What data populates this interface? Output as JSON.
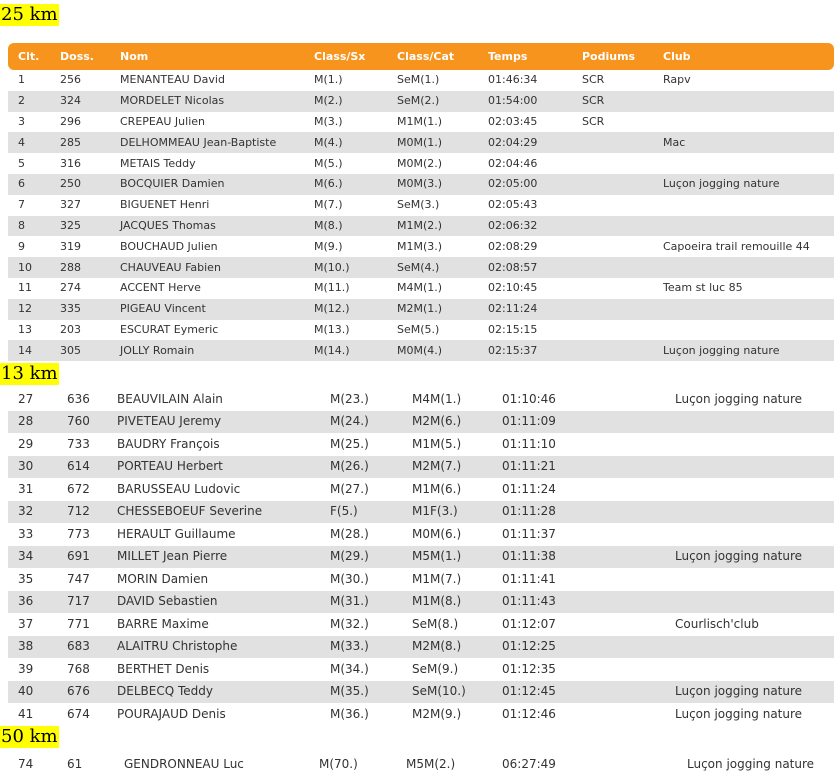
{
  "sections": [
    {
      "title": "25 km",
      "headers": [
        "Clt.",
        "Doss.",
        "Nom",
        "Class/Sx",
        "Class/Cat",
        "Temps",
        "Podiums",
        "Club"
      ],
      "rows": [
        [
          "1",
          "256",
          "MENANTEAU David",
          "M(1.)",
          "SeM(1.)",
          "01:46:34",
          "SCR",
          "Rapv"
        ],
        [
          "2",
          "324",
          "MORDELET Nicolas",
          "M(2.)",
          "SeM(2.)",
          "01:54:00",
          "SCR",
          ""
        ],
        [
          "3",
          "296",
          "CREPEAU Julien",
          "M(3.)",
          "M1M(1.)",
          "02:03:45",
          "SCR",
          ""
        ],
        [
          "4",
          "285",
          "DELHOMMEAU Jean-Baptiste",
          "M(4.)",
          "M0M(1.)",
          "02:04:29",
          "",
          "Mac"
        ],
        [
          "5",
          "316",
          "METAIS Teddy",
          "M(5.)",
          "M0M(2.)",
          "02:04:46",
          "",
          ""
        ],
        [
          "6",
          "250",
          "BOCQUIER Damien",
          "M(6.)",
          "M0M(3.)",
          "02:05:00",
          "",
          "Luçon jogging nature"
        ],
        [
          "7",
          "327",
          "BIGUENET Henri",
          "M(7.)",
          "SeM(3.)",
          "02:05:43",
          "",
          ""
        ],
        [
          "8",
          "325",
          "JACQUES Thomas",
          "M(8.)",
          "M1M(2.)",
          "02:06:32",
          "",
          ""
        ],
        [
          "9",
          "319",
          "BOUCHAUD Julien",
          "M(9.)",
          "M1M(3.)",
          "02:08:29",
          "",
          "Capoeira trail remouille 44"
        ],
        [
          "10",
          "288",
          "CHAUVEAU Fabien",
          "M(10.)",
          "SeM(4.)",
          "02:08:57",
          "",
          ""
        ],
        [
          "11",
          "274",
          "ACCENT Herve",
          "M(11.)",
          "M4M(1.)",
          "02:10:45",
          "",
          "Team st luc 85"
        ],
        [
          "12",
          "335",
          "PIGEAU Vincent",
          "M(12.)",
          "M2M(1.)",
          "02:11:24",
          "",
          ""
        ],
        [
          "13",
          "203",
          "ESCURAT Eymeric",
          "M(13.)",
          "SeM(5.)",
          "02:15:15",
          "",
          ""
        ],
        [
          "14",
          "305",
          "JOLLY Romain",
          "M(14.)",
          "M0M(4.)",
          "02:15:37",
          "",
          "Luçon jogging nature"
        ]
      ]
    },
    {
      "title": "13 km",
      "rows": [
        [
          "27",
          "636",
          "BEAUVILAIN Alain",
          "M(23.)",
          "M4M(1.)",
          "01:10:46",
          "Luçon jogging nature"
        ],
        [
          "28",
          "760",
          "PIVETEAU Jeremy",
          "M(24.)",
          "M2M(6.)",
          "01:11:09",
          ""
        ],
        [
          "29",
          "733",
          "BAUDRY François",
          "M(25.)",
          "M1M(5.)",
          "01:11:10",
          ""
        ],
        [
          "30",
          "614",
          "PORTEAU Herbert",
          "M(26.)",
          "M2M(7.)",
          "01:11:21",
          ""
        ],
        [
          "31",
          "672",
          "BARUSSEAU Ludovic",
          "M(27.)",
          "M1M(6.)",
          "01:11:24",
          ""
        ],
        [
          "32",
          "712",
          "CHESSEBOEUF Severine",
          "F(5.)",
          "M1F(3.)",
          "01:11:28",
          ""
        ],
        [
          "33",
          "773",
          "HERAULT Guillaume",
          "M(28.)",
          "M0M(6.)",
          "01:11:37",
          ""
        ],
        [
          "34",
          "691",
          "MILLET Jean Pierre",
          "M(29.)",
          "M5M(1.)",
          "01:11:38",
          "Luçon jogging nature"
        ],
        [
          "35",
          "747",
          "MORIN Damien",
          "M(30.)",
          "M1M(7.)",
          "01:11:41",
          ""
        ],
        [
          "36",
          "717",
          "DAVID Sebastien",
          "M(31.)",
          "M1M(8.)",
          "01:11:43",
          ""
        ],
        [
          "37",
          "771",
          "BARRE Maxime",
          "M(32.)",
          "SeM(8.)",
          "01:12:07",
          "Courlisch'club"
        ],
        [
          "38",
          "683",
          "ALAITRU Christophe",
          "M(33.)",
          "M2M(8.)",
          "01:12:25",
          ""
        ],
        [
          "39",
          "768",
          "BERTHET Denis",
          "M(34.)",
          "SeM(9.)",
          "01:12:35",
          ""
        ],
        [
          "40",
          "676",
          "DELBECQ Teddy",
          "M(35.)",
          "SeM(10.)",
          "01:12:45",
          "Luçon jogging nature"
        ],
        [
          "41",
          "674",
          "POURAJAUD Denis",
          "M(36.)",
          "M2M(9.)",
          "01:12:46",
          "Luçon jogging nature"
        ]
      ]
    },
    {
      "title": "50 km",
      "rows": [
        [
          "74",
          "61",
          "GENDRONNEAU Luc",
          "M(70.)",
          "M5M(2.)",
          "06:27:49",
          "Luçon jogging nature"
        ]
      ]
    }
  ]
}
